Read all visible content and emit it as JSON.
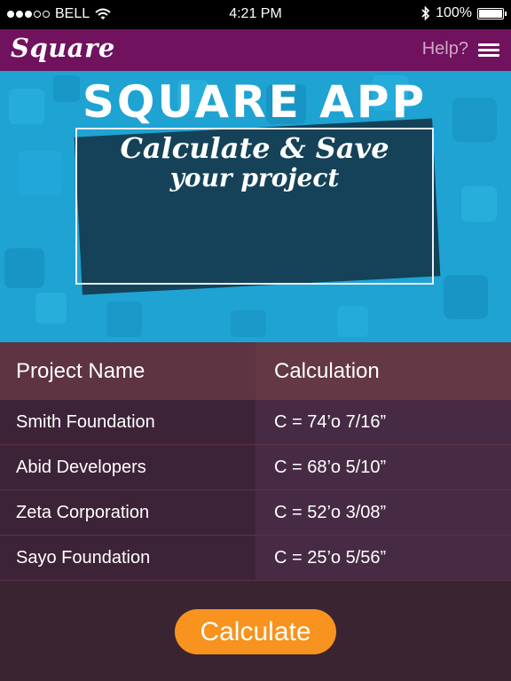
{
  "status_bar": {
    "carrier": "BELL",
    "time": "4:21 PM",
    "battery": "100%",
    "signal_icon": "signal-dots-icon",
    "wifi_icon": "wifi-icon",
    "bluetooth_icon": "bluetooth-icon",
    "battery_icon": "battery-icon"
  },
  "header": {
    "logo": "Square",
    "help_label": "Help?",
    "menu_icon": "hamburger-menu-icon",
    "background_color": "#70125e"
  },
  "hero": {
    "title": "SQUARE APP",
    "subtitle_line1": "Calculate & Save",
    "subtitle_line2": "your project"
  },
  "table": {
    "columns": [
      "Project Name",
      "Calculation"
    ],
    "rows": [
      {
        "name": "Smith Foundation",
        "calc": "C = 74’o  7/16”"
      },
      {
        "name": "Abid Developers",
        "calc": "C = 68’o  5/10”"
      },
      {
        "name": "Zeta Corporation",
        "calc": "C = 52’o  3/08”"
      },
      {
        "name": "Sayo Foundation",
        "calc": "C = 25’o  5/56”"
      }
    ]
  },
  "actions": {
    "calculate_label": "Calculate",
    "accent_color": "#f7931e"
  }
}
